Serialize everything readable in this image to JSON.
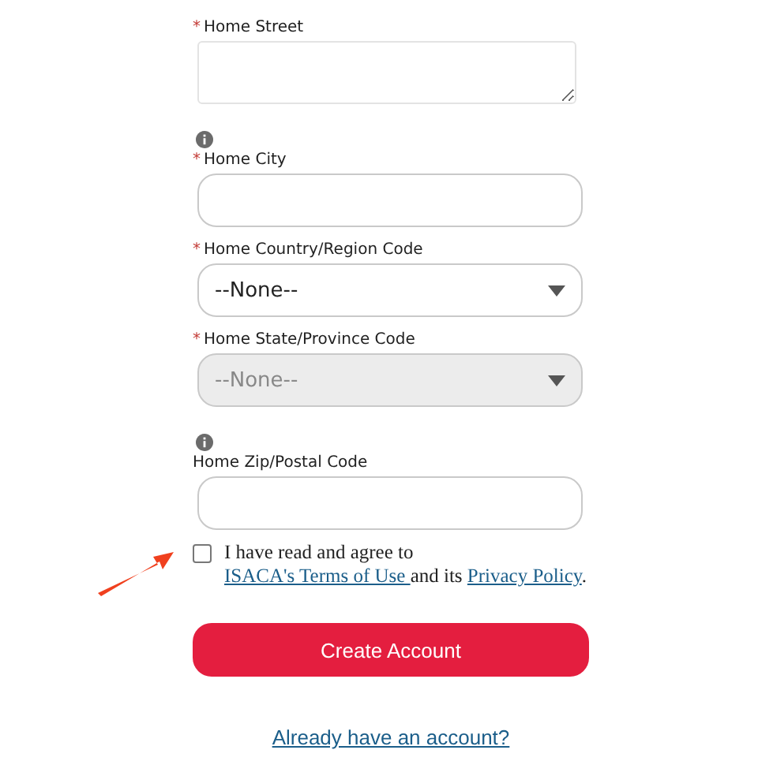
{
  "fields": [
    {
      "kind": "textarea",
      "required_mark": "*",
      "label": "Home Street",
      "info": false,
      "disabled": false
    },
    {
      "kind": "input",
      "required_mark": "*",
      "label": "Home City",
      "info": true,
      "disabled": false
    },
    {
      "kind": "select",
      "required_mark": "*",
      "label": "Home Country/Region Code",
      "info": false,
      "disabled": false,
      "value": "--None--"
    },
    {
      "kind": "select",
      "required_mark": "*",
      "label": "Home State/Province Code",
      "info": false,
      "disabled": true,
      "value": "--None--"
    },
    {
      "kind": "input",
      "label": "Home Zip/Postal Code",
      "info": true,
      "disabled": false
    }
  ],
  "agreement": {
    "checked": false,
    "parts": [
      {
        "kind": "text",
        "text": "I have read and agree to "
      },
      {
        "kind": "link",
        "text": "ISACA's Terms of Use "
      },
      {
        "kind": "text",
        "text": "and its "
      },
      {
        "kind": "link",
        "text": "Privacy Policy"
      },
      {
        "kind": "text",
        "text": "."
      }
    ]
  },
  "submit_button": "Create Account",
  "login_link": "Already have an account?"
}
